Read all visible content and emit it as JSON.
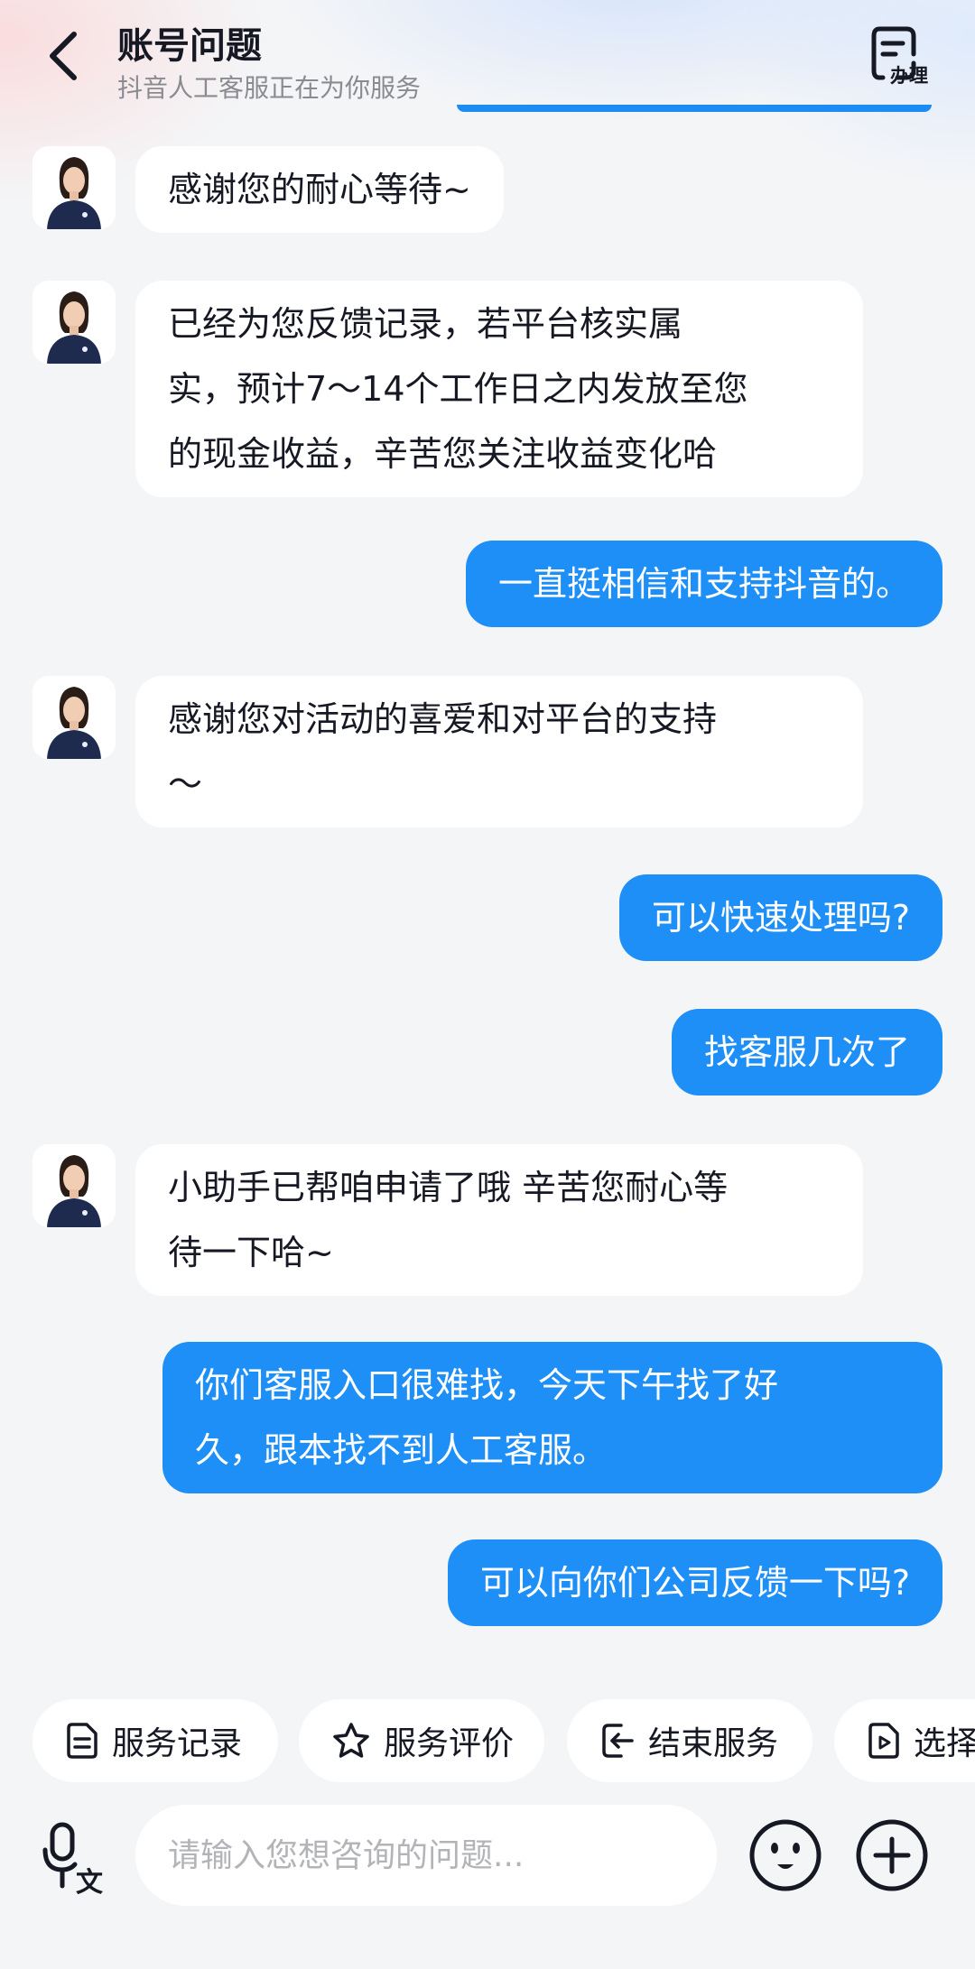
{
  "header": {
    "title": "账号问题",
    "subtitle": "抖音人工客服正在为你服务",
    "handle_label": "办理"
  },
  "messages": [
    {
      "from": "agent",
      "text": "感谢您的耐心等待~"
    },
    {
      "from": "agent",
      "lines": [
        "已经为您反馈记录，若平台核实属",
        "实，预计7～14个工作日之内发放至您",
        "的现金收益，辛苦您关注收益变化哈"
      ]
    },
    {
      "from": "user",
      "text": "一直挺相信和支持抖音的。"
    },
    {
      "from": "agent",
      "lines": [
        "感谢您对活动的喜爱和对平台的支持",
        "～"
      ]
    },
    {
      "from": "user",
      "text": "可以快速处理吗?"
    },
    {
      "from": "user",
      "text": "找客服几次了"
    },
    {
      "from": "agent",
      "lines": [
        "小助手已帮咱申请了哦 辛苦您耐心等",
        "待一下哈~"
      ]
    },
    {
      "from": "user",
      "lines": [
        "你们客服入口很难找，今天下午找了好",
        "久，跟本找不到人工客服。"
      ]
    },
    {
      "from": "user",
      "text": "可以向你们公司反馈一下吗?"
    }
  ],
  "quick_actions": [
    {
      "label": "服务记录",
      "icon": "document-icon"
    },
    {
      "label": "服务评价",
      "icon": "star-icon"
    },
    {
      "label": "结束服务",
      "icon": "exit-icon"
    },
    {
      "label": "选择",
      "icon": "video-file-icon"
    }
  ],
  "input": {
    "placeholder": "请输入您想咨询的问题...",
    "voice_icon": "mic-translate-icon",
    "emoji_icon": "emoji-icon",
    "plus_icon": "plus-icon"
  },
  "colors": {
    "user_bubble": "#1d8ff6",
    "agent_bubble": "#ffffff",
    "background": "#f4f5f7",
    "accent_line": "#1c8cf5"
  }
}
